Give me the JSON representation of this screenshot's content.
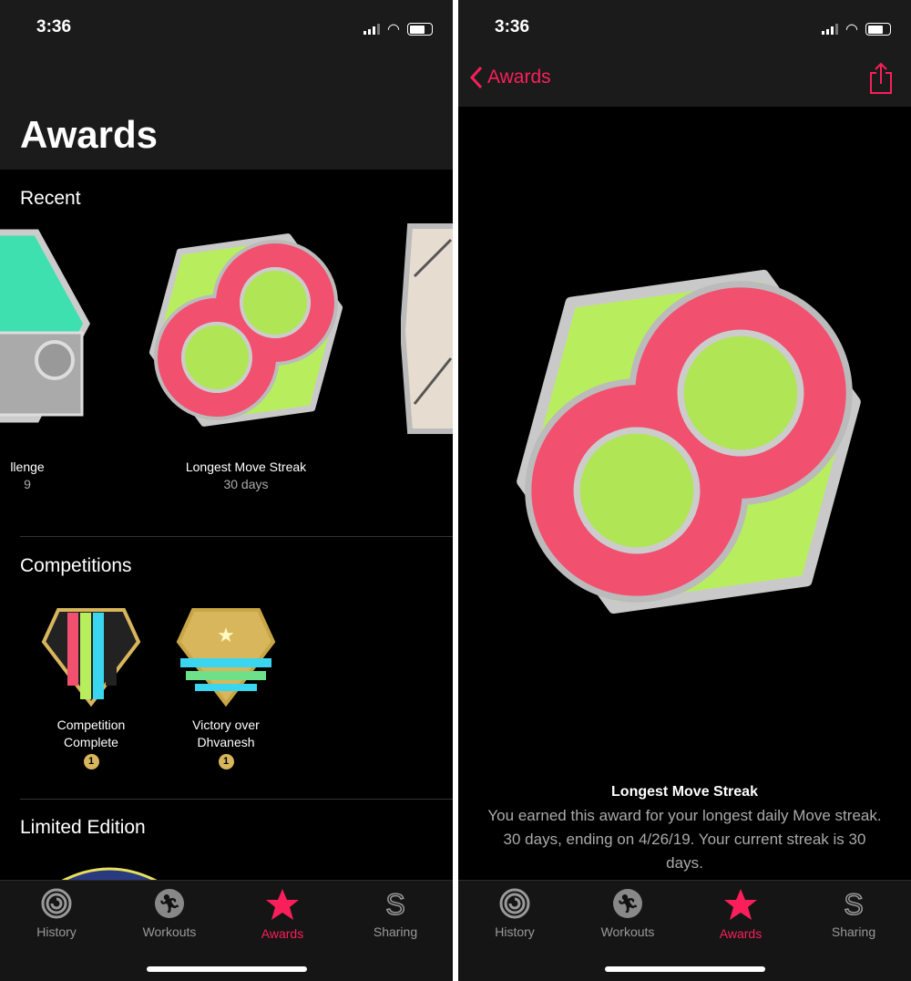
{
  "status": {
    "time": "3:36"
  },
  "left": {
    "title": "Awards",
    "sections": {
      "recent": "Recent",
      "competitions": "Competitions",
      "limited": "Limited Edition"
    },
    "recent": [
      {
        "name": "llenge",
        "detail": "9"
      },
      {
        "name": "Longest Move Streak",
        "detail": "30 days"
      }
    ],
    "competitions": [
      {
        "name": "Competition Complete",
        "count": "1"
      },
      {
        "name": "Victory over Dhvanesh",
        "count": "1"
      }
    ]
  },
  "right": {
    "back_label": "Awards",
    "award_title": "Longest Move Streak",
    "award_description": "You earned this award for your longest daily Move streak. 30 days, ending on 4/26/19. Your current streak is 30 days."
  },
  "tabs": [
    {
      "label": "History",
      "icon": "history-rings-icon"
    },
    {
      "label": "Workouts",
      "icon": "runner-icon"
    },
    {
      "label": "Awards",
      "icon": "star-icon",
      "active": true
    },
    {
      "label": "Sharing",
      "icon": "sharing-icon"
    }
  ],
  "colors": {
    "accent": "#fa1f5a",
    "badge_green": "#b8ee5e",
    "badge_pink": "#f2506f"
  }
}
